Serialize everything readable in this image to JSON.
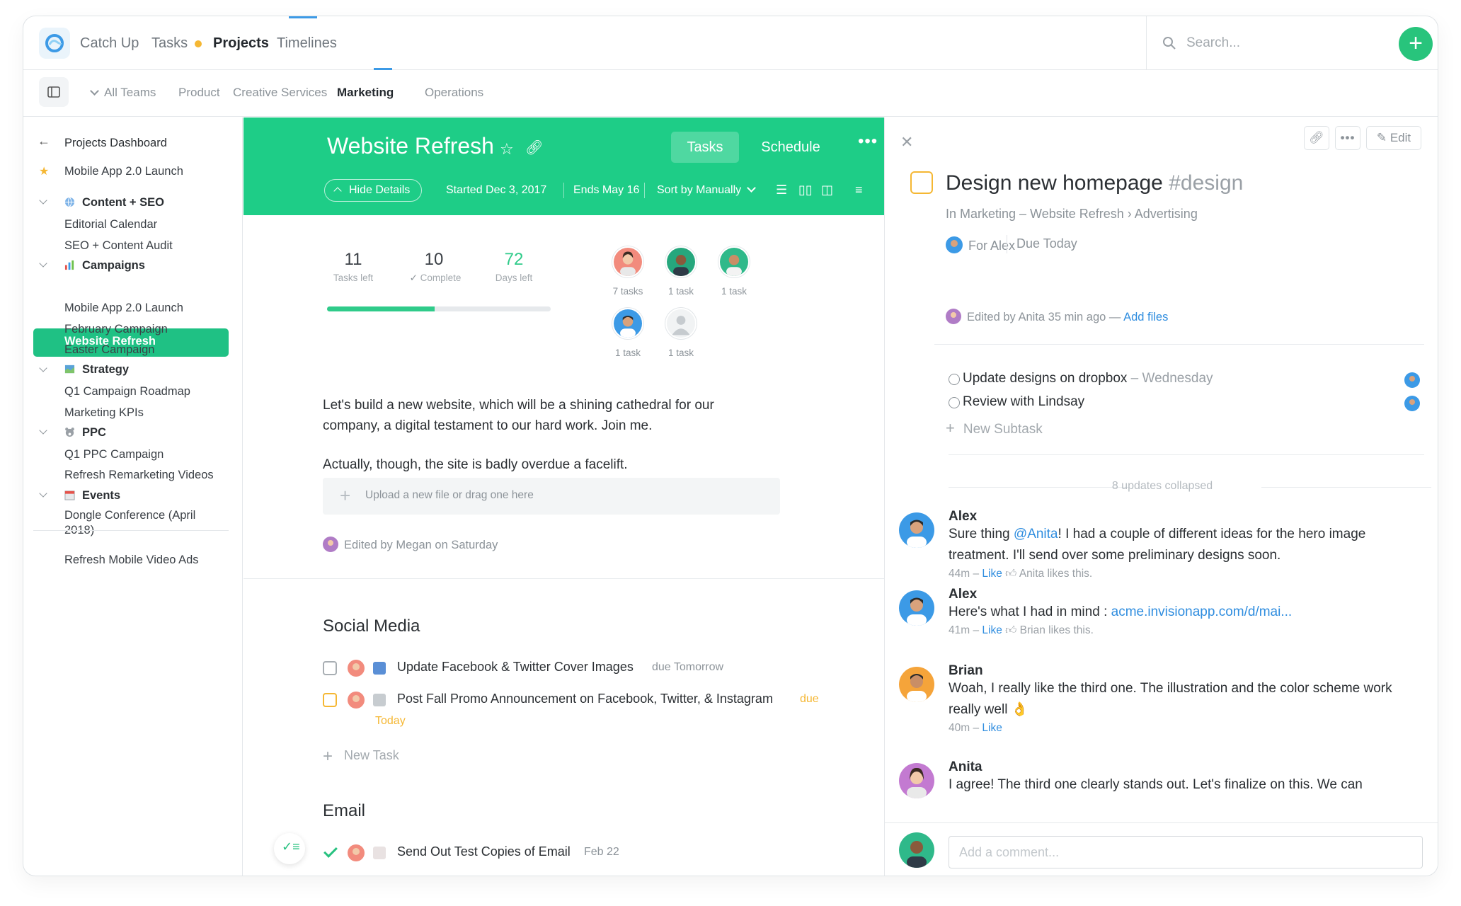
{
  "nav": {
    "tabs": [
      {
        "label": "Catch Up"
      },
      {
        "label": "Tasks"
      },
      {
        "label": "Projects"
      },
      {
        "label": "Timelines"
      }
    ],
    "search_placeholder": "Search...",
    "add_icon": "plus-icon"
  },
  "subnav": {
    "teams": [
      "All Teams",
      "Product",
      "Creative Services",
      "Marketing",
      "Operations"
    ],
    "active": "Marketing"
  },
  "sidebar": {
    "back": "Projects Dashboard",
    "starred": "Mobile App 2.0 Launch",
    "groups": [
      {
        "label": "Content + SEO",
        "icon": "globe-icon",
        "items": [
          "Editorial Calendar",
          "SEO + Content Audit"
        ]
      },
      {
        "label": "Campaigns",
        "icon": "bar-chart-icon",
        "items": [
          "Website Refresh",
          "Mobile App 2.0 Launch",
          "February Campaign",
          "Easter Campaign"
        ]
      },
      {
        "label": "Strategy",
        "icon": "map-icon",
        "items": [
          "Q1 Campaign Roadmap",
          "Marketing KPIs"
        ]
      },
      {
        "label": "PPC",
        "icon": "bear-icon",
        "items": [
          "Q1 PPC Campaign",
          "Refresh Remarketing Videos"
        ]
      },
      {
        "label": "Events",
        "icon": "calendar-icon",
        "items": [
          "Dongle Conference (April 2018)"
        ]
      }
    ],
    "footer_item": "Refresh Mobile Video Ads",
    "active_item": "Website Refresh"
  },
  "project": {
    "title": "Website Refresh",
    "tab_tasks": "Tasks",
    "tab_schedule": "Schedule",
    "hide_details": "Hide Details",
    "started": "Started Dec 3, 2017",
    "ends": "Ends May 16",
    "sort": "Sort by Manually",
    "accent": "#1ecd87"
  },
  "stats": {
    "tasks_left": {
      "value": "11",
      "label": "Tasks left"
    },
    "complete": {
      "value": "10",
      "label": "Complete"
    },
    "days_left": {
      "value": "72",
      "label": "Days left"
    },
    "progress_fraction": 0.48
  },
  "assignees": [
    {
      "count": "7 tasks"
    },
    {
      "count": "1 task"
    },
    {
      "count": "1 task"
    },
    {
      "count": "1 task"
    },
    {
      "count": "1 task"
    }
  ],
  "description": {
    "p1": "Let's build a new website, which will be a shining cathedral for our company, a digital testament to our hard work. Join me.",
    "p2": "Actually, though, the site is badly overdue a facelift.",
    "upload": "Upload a new file or drag one here",
    "edited": "Edited by Megan on Saturday"
  },
  "sections": [
    {
      "title": "Social Media",
      "tasks": [
        {
          "text": "Update Facebook & Twitter Cover Images",
          "due": "due Tomorrow"
        },
        {
          "text": "Post Fall Promo Announcement on Facebook, Twitter, & Instagram",
          "due": "due",
          "due2": "Today"
        }
      ],
      "new_task": "New Task"
    },
    {
      "title": "Email",
      "tasks": [
        {
          "text": "Send Out Test Copies of Email",
          "due": "Feb 22"
        }
      ]
    }
  ],
  "detail": {
    "edit": "Edit",
    "title": "Design new homepage",
    "tag": "#design",
    "breadcrumb": "In Marketing – Website Refresh › Advertising",
    "for": "For Alex",
    "due": "Due Today",
    "edited_by": "Edited by Anita 35 min ago —",
    "add_files": "Add files",
    "subtasks": [
      {
        "text": "Update designs on dropbox",
        "when": " – Wednesday"
      },
      {
        "text": "Review with Lindsay",
        "when": ""
      }
    ],
    "new_subtask": "New Subtask",
    "collapsed": "8 updates collapsed",
    "comment_placeholder": "Add a comment..."
  },
  "comments": [
    {
      "name": "Alex",
      "pre": "Sure thing ",
      "mention": "@Anita",
      "post": "! I had a couple of different ideas for the hero image treatment. I'll send over some preliminary designs soon.",
      "time": "44m –",
      "like": "Like",
      "likes": "Anita likes this."
    },
    {
      "name": "Alex",
      "pre": "Here's what I had in mind : ",
      "mention": "acme.invisionapp.com/d/mai...",
      "post": "",
      "time": "41m –",
      "like": "Like",
      "likes": "Brian likes this."
    },
    {
      "name": "Brian",
      "pre": "Woah, I really like the third one. The illustration and the color scheme work really well 👌",
      "mention": "",
      "post": "",
      "time": "40m –",
      "like": "Like",
      "likes": ""
    },
    {
      "name": "Anita",
      "pre": "I agree! The third one clearly stands out. Let's finalize on this. We can",
      "mention": "",
      "post": "",
      "time": "",
      "like": "",
      "likes": ""
    }
  ]
}
